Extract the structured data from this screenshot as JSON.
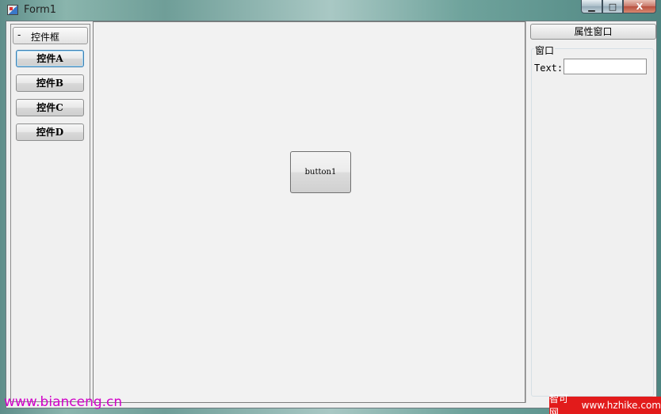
{
  "window": {
    "title": "Form1",
    "caption_minimize": "▁",
    "caption_maximize": "□",
    "caption_close": "X"
  },
  "toolbox": {
    "collapse_symbol": "-",
    "header_label": "控件框",
    "buttons": [
      {
        "label": "控件A"
      },
      {
        "label": "控件B"
      },
      {
        "label": "控件C"
      },
      {
        "label": "控件D"
      }
    ]
  },
  "designer": {
    "button_label": "button1"
  },
  "properties": {
    "header_label": "属性窗口",
    "group_label": "窗口",
    "text_label": "Text:",
    "text_value": ""
  },
  "watermarks": {
    "left": "www.bianceng.cn",
    "right_cn": "智可网",
    "right_url": "www.hzhike.com"
  },
  "colors": {
    "watermark_left": "#d100c8",
    "watermark_right_bg": "#e21b1b"
  }
}
